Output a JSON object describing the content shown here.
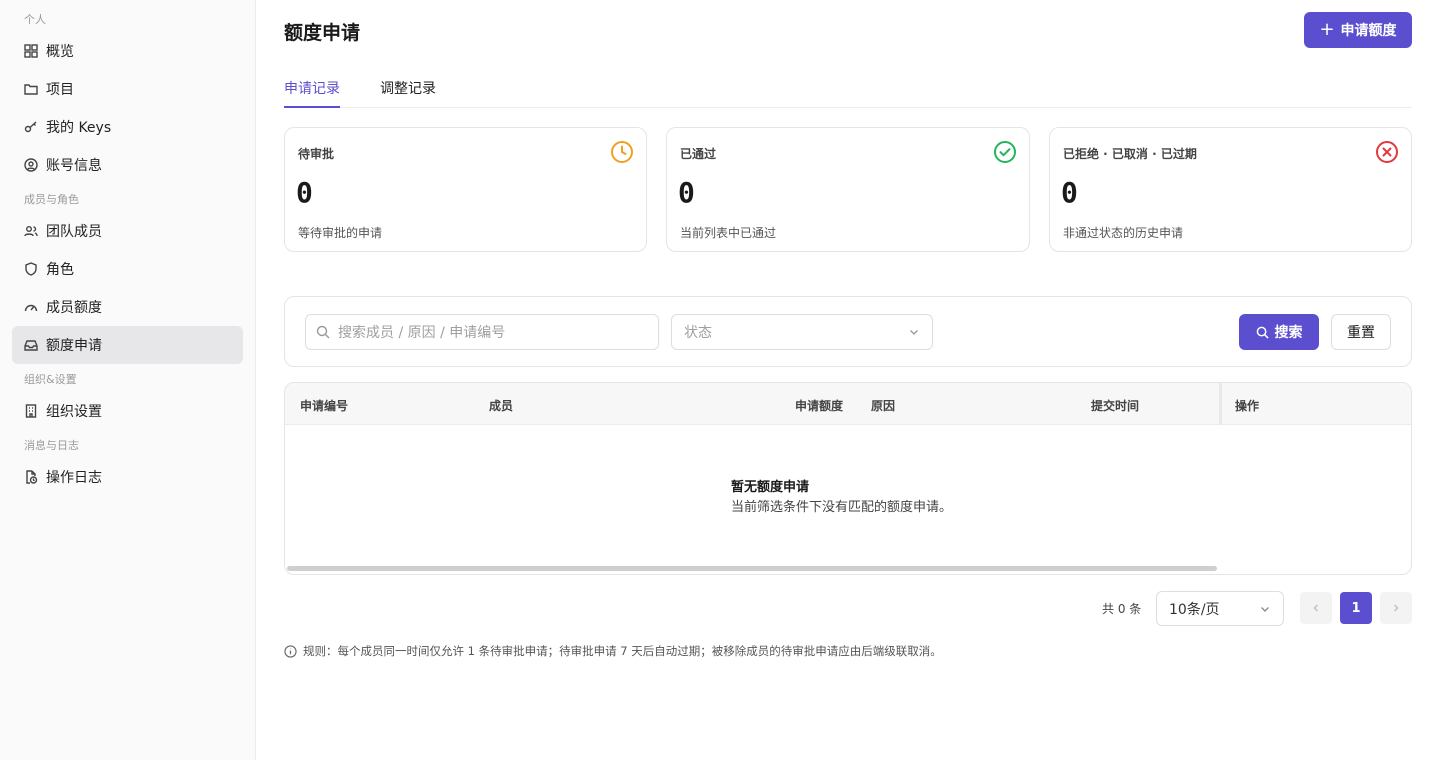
{
  "sidebar": {
    "sections": [
      "个人",
      "成员与角色",
      "组织&设置",
      "消息与日志"
    ],
    "items": [
      {
        "label": "概览",
        "icon": "grid-icon"
      },
      {
        "label": "项目",
        "icon": "folder-icon"
      },
      {
        "label": "我的 Keys",
        "icon": "key-icon"
      },
      {
        "label": "账号信息",
        "icon": "user-circle-icon"
      },
      {
        "label": "团队成员",
        "icon": "users-icon"
      },
      {
        "label": "角色",
        "icon": "shield-icon"
      },
      {
        "label": "成员额度",
        "icon": "gauge-icon"
      },
      {
        "label": "额度申请",
        "icon": "inbox-icon",
        "active": true
      },
      {
        "label": "组织设置",
        "icon": "building-icon"
      },
      {
        "label": "操作日志",
        "icon": "file-clock-icon"
      }
    ]
  },
  "header": {
    "title": "额度申请",
    "primary_button": "申请额度"
  },
  "tabs": [
    {
      "label": "申请记录",
      "active": true
    },
    {
      "label": "调整记录"
    }
  ],
  "cards": [
    {
      "label": "待审批",
      "value": "0",
      "sub": "等待审批的申请",
      "icon": "clock-icon",
      "color": "#f0a020"
    },
    {
      "label": "已通过",
      "value": "0",
      "sub": "当前列表中已通过",
      "icon": "check-circle-icon",
      "color": "#22b55a"
    },
    {
      "label": "已拒绝 · 已取消 · 已过期",
      "value": "0",
      "sub": "非通过状态的历史申请",
      "icon": "x-circle-icon",
      "color": "#e0393e"
    }
  ],
  "filter": {
    "search_placeholder": "搜索成员 / 原因 / 申请编号",
    "status_placeholder": "状态",
    "search_button": "搜索",
    "reset_button": "重置"
  },
  "table": {
    "columns": [
      "申请编号",
      "成员",
      "申请额度",
      "原因",
      "提交时间",
      "操作"
    ],
    "empty_title": "暂无额度申请",
    "empty_sub": "当前筛选条件下没有匹配的额度申请。"
  },
  "pagination": {
    "total": "共 0 条",
    "page_size": "10条/页",
    "current_page": "1"
  },
  "rule_text": "规则：每个成员同一时间仅允许 1 条待审批申请；待审批申请 7 天后自动过期；被移除成员的待审批申请应由后端级联取消。",
  "colors": {
    "accent": "#5b4fcf"
  }
}
